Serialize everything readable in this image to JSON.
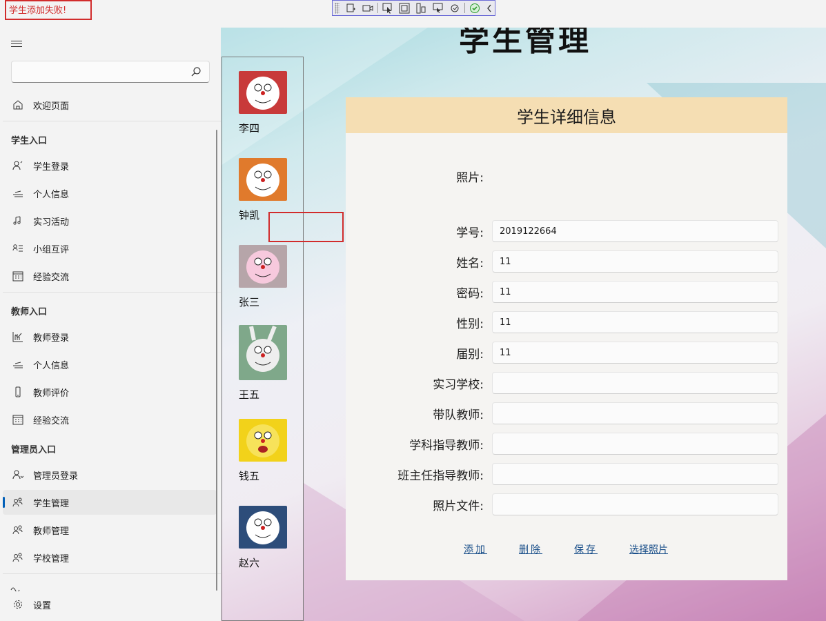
{
  "error_message": "学生添加失败!",
  "sidebar": {
    "search": {
      "placeholder": ""
    },
    "welcome": "欢迎页面",
    "sections": {
      "student": "学生入口",
      "teacher": "教师入口",
      "admin": "管理员入口"
    },
    "items": [
      {
        "label": "学生登录",
        "icon": "person-icon"
      },
      {
        "label": "个人信息",
        "icon": "tray-icon"
      },
      {
        "label": "实习活动",
        "icon": "music-icon"
      },
      {
        "label": "小组互评",
        "icon": "list-person-icon"
      },
      {
        "label": "经验交流",
        "icon": "calendar-icon"
      },
      {
        "label": "教师登录",
        "icon": "chart-icon"
      },
      {
        "label": "个人信息",
        "icon": "tray-icon"
      },
      {
        "label": "教师评价",
        "icon": "phone-icon"
      },
      {
        "label": "经验交流",
        "icon": "calendar-icon"
      },
      {
        "label": "管理员登录",
        "icon": "person-icon"
      },
      {
        "label": "学生管理",
        "icon": "people-icon"
      },
      {
        "label": "教师管理",
        "icon": "people-icon"
      },
      {
        "label": "学校管理",
        "icon": "people-icon"
      }
    ],
    "settings": "设置"
  },
  "main": {
    "title": "学生管理",
    "students": [
      {
        "name": "李四",
        "color": "#c83a3a"
      },
      {
        "name": "钟凯",
        "color": "#e07a2c"
      },
      {
        "name": "张三",
        "color": "#f3b8d4"
      },
      {
        "name": "王五",
        "color": "#e8e8e8"
      },
      {
        "name": "钱五",
        "color": "#f2d21a"
      },
      {
        "name": "赵六",
        "color": "#2d4d7a"
      }
    ],
    "panel": {
      "header": "学生详细信息",
      "photo_label": "照片:",
      "fields": [
        {
          "label": "学号:",
          "value": "2019122664"
        },
        {
          "label": "姓名:",
          "value": "11"
        },
        {
          "label": "密码:",
          "value": "11"
        },
        {
          "label": "性别:",
          "value": "11"
        },
        {
          "label": "届别:",
          "value": "11"
        },
        {
          "label": "实习学校:",
          "value": ""
        },
        {
          "label": "带队教师:",
          "value": ""
        },
        {
          "label": "学科指导教师:",
          "value": ""
        },
        {
          "label": "班主任指导教师:",
          "value": ""
        },
        {
          "label": "照片文件:",
          "value": ""
        }
      ],
      "buttons": [
        "添加",
        "删除",
        "保存",
        "选择照片"
      ]
    }
  }
}
